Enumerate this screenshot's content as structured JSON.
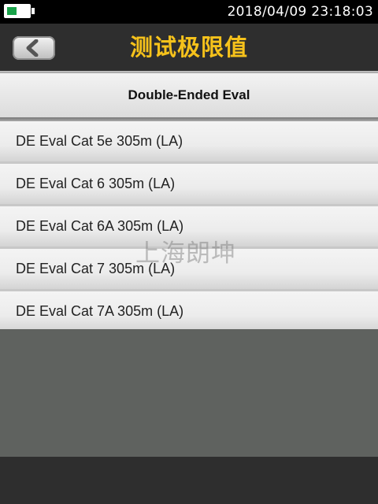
{
  "status_bar": {
    "datetime": "2018/04/09  23:18:03",
    "battery_level": 0.45,
    "battery_color": "#1aa34a"
  },
  "header": {
    "back_icon": "chevron-left-icon",
    "title": "测试极限值",
    "title_color": "#f6c21b"
  },
  "list": {
    "section_label": "Double-Ended Eval",
    "items": [
      {
        "label": "DE Eval Cat 5e 305m (LA)"
      },
      {
        "label": "DE Eval Cat 6 305m (LA)"
      },
      {
        "label": "DE Eval Cat 6A 305m (LA)"
      },
      {
        "label": "DE Eval Cat 7 305m (LA)"
      },
      {
        "label": "DE Eval Cat 7A 305m (LA)"
      }
    ]
  },
  "watermark": "上海朗坤"
}
